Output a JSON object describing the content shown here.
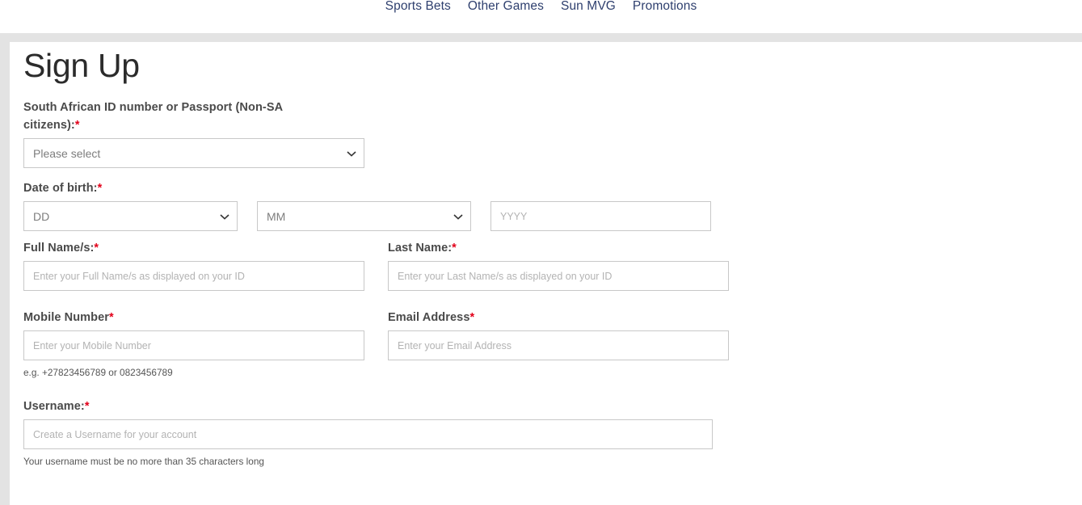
{
  "nav": {
    "items": [
      {
        "label": "Sports Bets"
      },
      {
        "label": "Other Games"
      },
      {
        "label": "Sun MVG"
      },
      {
        "label": "Promotions"
      }
    ]
  },
  "page": {
    "title": "Sign Up"
  },
  "colors": {
    "nav_link": "#2e3f6e",
    "required_asterisk": "#e2001a",
    "frame_gray": "#e3e3e3",
    "field_border": "#c8c8c8",
    "placeholder": "#b3b3b3",
    "label": "#4a4a4a",
    "title": "#2b2b2b"
  },
  "form": {
    "id_field": {
      "label_line1": "South African ID number or Passport (Non-SA",
      "label_line2": "citizens):",
      "asterisk": "*",
      "selected_option": "Please select",
      "options": [
        "Please select"
      ]
    },
    "dob": {
      "label": "Date of birth:",
      "asterisk": "*",
      "day": {
        "selected_option": "DD",
        "options": [
          "DD"
        ]
      },
      "month": {
        "selected_option": "MM",
        "options": [
          "MM"
        ]
      },
      "year": {
        "value": "",
        "placeholder": "YYYY"
      }
    },
    "full_name": {
      "label": "Full Name/s:",
      "asterisk": "*",
      "value": "",
      "placeholder": "Enter your Full Name/s as displayed on your ID"
    },
    "last_name": {
      "label": "Last Name:",
      "asterisk": "*",
      "value": "",
      "placeholder": "Enter your Last Name/s as displayed on your ID"
    },
    "mobile": {
      "label": "Mobile Number",
      "asterisk": "*",
      "value": "",
      "placeholder": "Enter your Mobile Number",
      "hint": "e.g. +27823456789 or 0823456789"
    },
    "email": {
      "label": "Email Address",
      "asterisk": "*",
      "value": "",
      "placeholder": "Enter your Email Address"
    },
    "username": {
      "label": "Username:",
      "asterisk": "*",
      "value": "",
      "placeholder": "Create a Username for your account",
      "hint": "Your username must be no more than 35 characters long"
    }
  },
  "icons": {
    "chevron_down": "chevron-down-icon"
  }
}
